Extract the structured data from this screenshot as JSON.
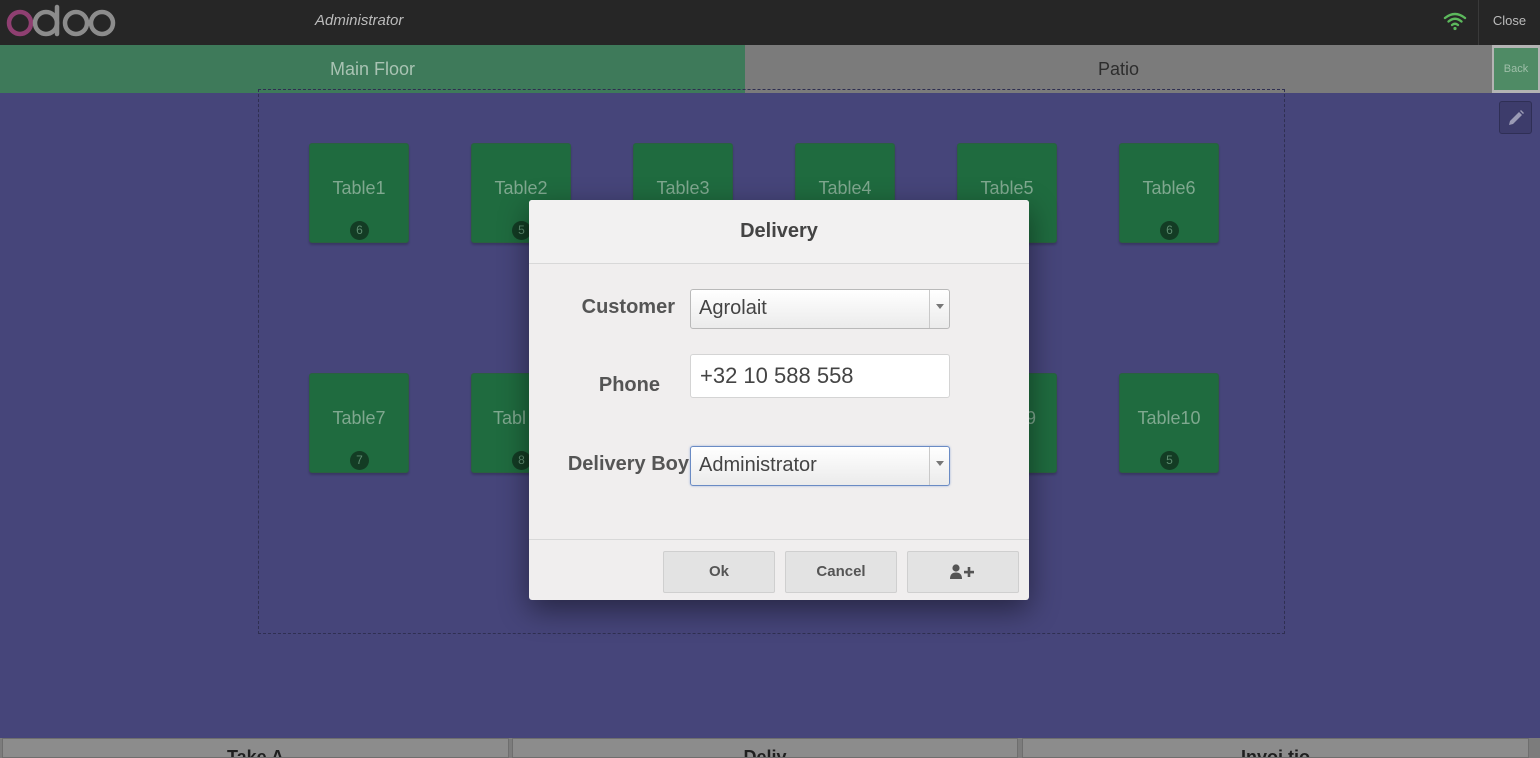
{
  "header": {
    "logo_alt": "odoo",
    "cashier_name": "Administrator",
    "close_label": "Close",
    "connection_icon": "wifi-icon",
    "connection_color": "#5cb85c"
  },
  "floors": {
    "tabs": [
      {
        "label": "Main Floor",
        "active": true
      },
      {
        "label": "Patio",
        "active": false
      }
    ],
    "back_label": "Back"
  },
  "floor_map": {
    "edit_icon": "pencil-icon",
    "tables": [
      {
        "name": "Table1",
        "seats": "6"
      },
      {
        "name": "Table2",
        "seats": "5"
      },
      {
        "name": "Table3",
        "seats": ""
      },
      {
        "name": "Table4",
        "seats": ""
      },
      {
        "name": "Table5",
        "seats": ""
      },
      {
        "name": "Table6",
        "seats": "6"
      },
      {
        "name": "Table7",
        "seats": "7"
      },
      {
        "name": "Tabl",
        "seats": "8"
      },
      {
        "name": "9",
        "seats": ""
      },
      {
        "name": "Table10",
        "seats": "5"
      }
    ]
  },
  "bottom_buttons": [
    {
      "label": "Take A"
    },
    {
      "label": "Deliv"
    },
    {
      "label": "Invoi tio"
    }
  ],
  "popup": {
    "title": "Delivery",
    "customer_label": "Customer",
    "customer_value": "Agrolait",
    "phone_label": "Phone",
    "phone_value": "+32 10 588 558",
    "delivery_boy_label": "Delivery Boy",
    "delivery_boy_value": "Administrator",
    "ok_label": "Ok",
    "cancel_label": "Cancel",
    "add_customer_icon": "add-user-icon"
  }
}
